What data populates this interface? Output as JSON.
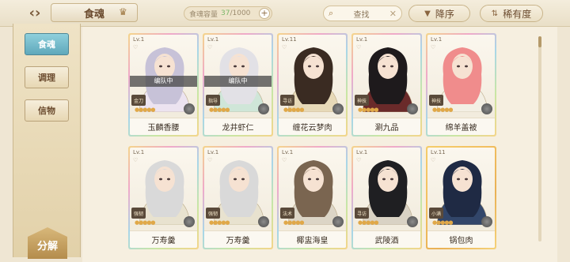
{
  "header": {
    "title": "食魂",
    "capacity_label": "食魂容量",
    "capacity_current": "37",
    "capacity_max": "/1000",
    "search_label": "查找",
    "sort_label": "降序",
    "filter_label": "稀有度"
  },
  "sidebar": {
    "tabs": [
      {
        "label": "食魂",
        "active": true
      },
      {
        "label": "调理",
        "active": false
      },
      {
        "label": "信物",
        "active": false
      }
    ],
    "decompose_label": "分解"
  },
  "cards": [
    {
      "level": "Lv.1",
      "name": "玉麟香腰",
      "formation": "编队中",
      "badge": "金刀",
      "frame": "rainbow",
      "hair": "#c7c2d8",
      "robe": "#ece3f0"
    },
    {
      "level": "Lv.1",
      "name": "龙井虾仁",
      "formation": "编队中",
      "badge": "指导",
      "frame": "rainbow",
      "hair": "#e2e1e6",
      "robe": "#cfe6d8"
    },
    {
      "level": "Lv.11",
      "name": "缠花云梦肉",
      "formation": "",
      "badge": "寻访",
      "frame": "rainbow",
      "hair": "#3a2b22",
      "robe": "#e7d9b8"
    },
    {
      "level": "Lv.1",
      "name": "涮九品",
      "formation": "",
      "badge": "神技",
      "frame": "rainbow",
      "hair": "#1e1a1c",
      "robe": "#6a2a2a"
    },
    {
      "level": "Lv.1",
      "name": "绵羊盖被",
      "formation": "",
      "badge": "神技",
      "frame": "rainbow",
      "hair": "#f08c8c",
      "robe": "#f3efe4"
    },
    {
      "level": "Lv.1",
      "name": "万寿羹",
      "formation": "",
      "badge": "强韧",
      "frame": "rainbow",
      "hair": "#d9d9d9",
      "robe": "#e8e2cf"
    },
    {
      "level": "Lv.1",
      "name": "万寿羹",
      "formation": "",
      "badge": "强韧",
      "frame": "rainbow",
      "hair": "#d9d9d9",
      "robe": "#e8e2cf"
    },
    {
      "level": "Lv.1",
      "name": "椰盅海皇",
      "formation": "",
      "badge": "法术",
      "frame": "rainbow",
      "hair": "#7a6550",
      "robe": "#dcd5c6"
    },
    {
      "level": "Lv.1",
      "name": "武陵酒",
      "formation": "",
      "badge": "寻访",
      "frame": "rainbow",
      "hair": "#1f1f22",
      "robe": "#d9d2c4"
    },
    {
      "level": "Lv.11",
      "name": "锅包肉",
      "formation": "",
      "badge": "小满",
      "frame": "gold",
      "hair": "#1f2a44",
      "robe": "#32466a"
    }
  ],
  "icons": {
    "back": "back-arrow-icon",
    "search": "search-icon",
    "clear": "clear-icon",
    "sort": "sort-icon",
    "filter": "filter-icon"
  }
}
